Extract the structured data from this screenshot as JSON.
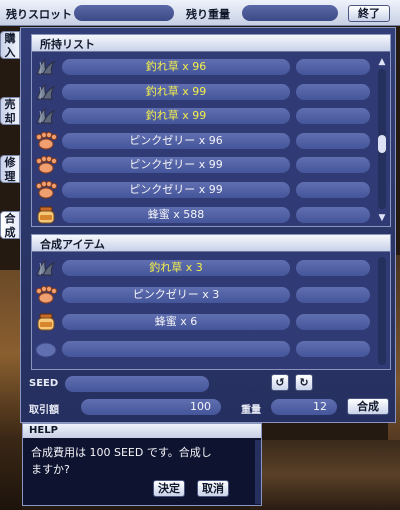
{
  "topbar": {
    "slots_label": "残りスロット",
    "weight_label": "残り重量",
    "close_label": "終了"
  },
  "tabs": [
    "購入",
    "売却",
    "修理",
    "合成"
  ],
  "owned_list": {
    "title": "所持リスト",
    "items": [
      {
        "name": "釣れ草 x 96",
        "icon": "grass-icon",
        "color": "yellow"
      },
      {
        "name": "釣れ草 x 99",
        "icon": "grass-icon",
        "color": "yellow"
      },
      {
        "name": "釣れ草 x 99",
        "icon": "grass-icon",
        "color": "yellow"
      },
      {
        "name": "ピンクゼリー x 96",
        "icon": "paw-icon",
        "color": "white"
      },
      {
        "name": "ピンクゼリー x 99",
        "icon": "paw-icon",
        "color": "white"
      },
      {
        "name": "ピンクゼリー x 99",
        "icon": "paw-icon",
        "color": "white"
      },
      {
        "name": "蜂蜜 x 588",
        "icon": "honey-jar-icon",
        "color": "white"
      }
    ]
  },
  "synth_list": {
    "title": "合成アイテム",
    "items": [
      {
        "name": "釣れ草 x 3",
        "icon": "grass-icon",
        "color": "yellow"
      },
      {
        "name": "ピンクゼリー x 3",
        "icon": "paw-icon",
        "color": "white"
      },
      {
        "name": "蜂蜜 x 6",
        "icon": "honey-jar-icon",
        "color": "white"
      },
      {
        "name": "",
        "icon": "empty-slot-icon",
        "color": "white"
      }
    ]
  },
  "seed": {
    "label": "SEED"
  },
  "trade": {
    "label": "取引額",
    "value": "100"
  },
  "weight": {
    "label": "重量",
    "value": "12"
  },
  "synth_button": "合成",
  "help": {
    "title": "HELP",
    "line1": "合成費用は 100 SEED です。合成し",
    "line2": "ますか?",
    "confirm_label": "決定",
    "cancel_label": "取消"
  },
  "colors": {
    "window": "#2a3566",
    "field": "#45559a",
    "highlight_text": "#f4ef4a"
  }
}
